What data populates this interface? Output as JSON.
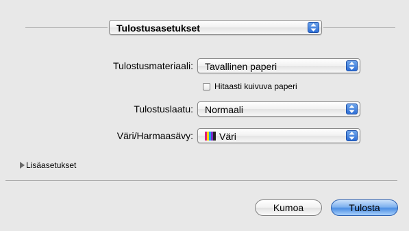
{
  "preset_popup": {
    "value": "Tulostusasetukset"
  },
  "form": {
    "media_label": "Tulostusmateriaali:",
    "media_value": "Tavallinen paperi",
    "slow_dry_label": "Hitaasti kuivuva paperi",
    "slow_dry_checked": false,
    "quality_label": "Tulostuslaatu:",
    "quality_value": "Normaali",
    "color_label": "Väri/Harmaasävy:",
    "color_value": "Väri"
  },
  "advanced": {
    "label": "Lisäasetukset",
    "expanded": false
  },
  "buttons": {
    "cancel_label": "Kumoa",
    "print_label": "Tulosta"
  },
  "colors": {
    "accent": "#4d8fe4",
    "background": "#e8e8e8"
  },
  "icons": {
    "popup_arrows": "up-down-arrows-icon",
    "disclosure": "disclosure-triangle-right-icon",
    "color_swatch": "color-bars-icon"
  }
}
